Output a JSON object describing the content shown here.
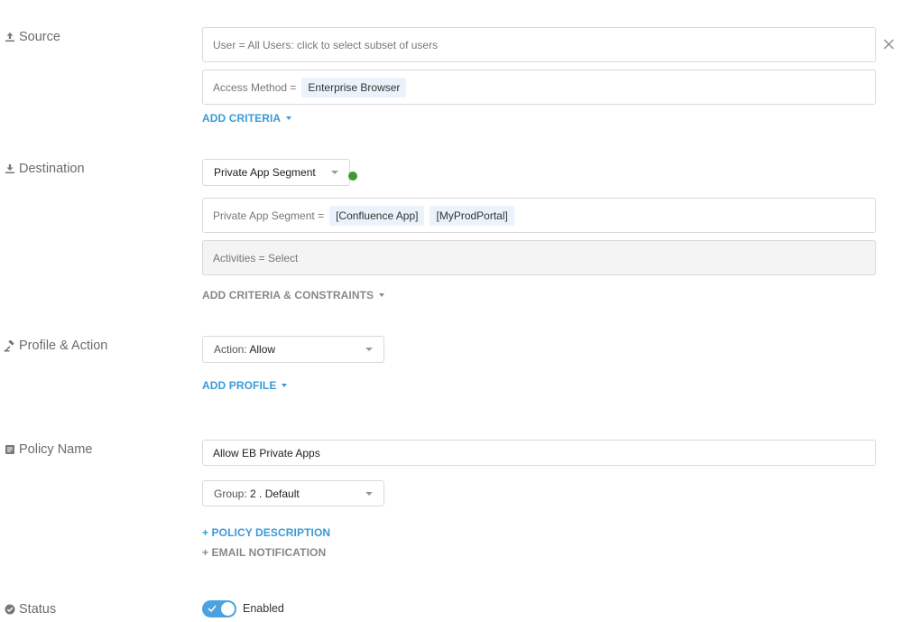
{
  "source": {
    "label": "Source",
    "icon": "upload-icon",
    "user_field": "User = All Users: click to select subset of users",
    "access_method_label": "Access Method =",
    "access_method_value": "Enterprise Browser",
    "add_criteria": "ADD CRITERIA"
  },
  "destination": {
    "label": "Destination",
    "icon": "download-icon",
    "type_select": "Private App Segment",
    "segment_label": "Private App Segment =",
    "segments": [
      "[Confluence App]",
      "[MyProdPortal]"
    ],
    "activities": "Activities = Select",
    "add_criteria_constraints": "ADD CRITERIA & CONSTRAINTS",
    "status_color": "#3f9b2f"
  },
  "profile_action": {
    "label": "Profile & Action",
    "icon": "gavel-icon",
    "action_label": "Action:",
    "action_value": "Allow",
    "add_profile": "ADD PROFILE"
  },
  "policy_name": {
    "label": "Policy Name",
    "icon": "document-icon",
    "value": "Allow EB Private Apps",
    "group_label": "Group:",
    "group_value": "2 . Default",
    "policy_description": "+ POLICY DESCRIPTION",
    "email_notification": "+ EMAIL NOTIFICATION"
  },
  "status": {
    "label": "Status",
    "icon": "check-circle-icon",
    "toggle_label": "Enabled",
    "enabled": true
  },
  "colors": {
    "accent": "#3a9ad9",
    "toggle": "#4aa3df"
  }
}
